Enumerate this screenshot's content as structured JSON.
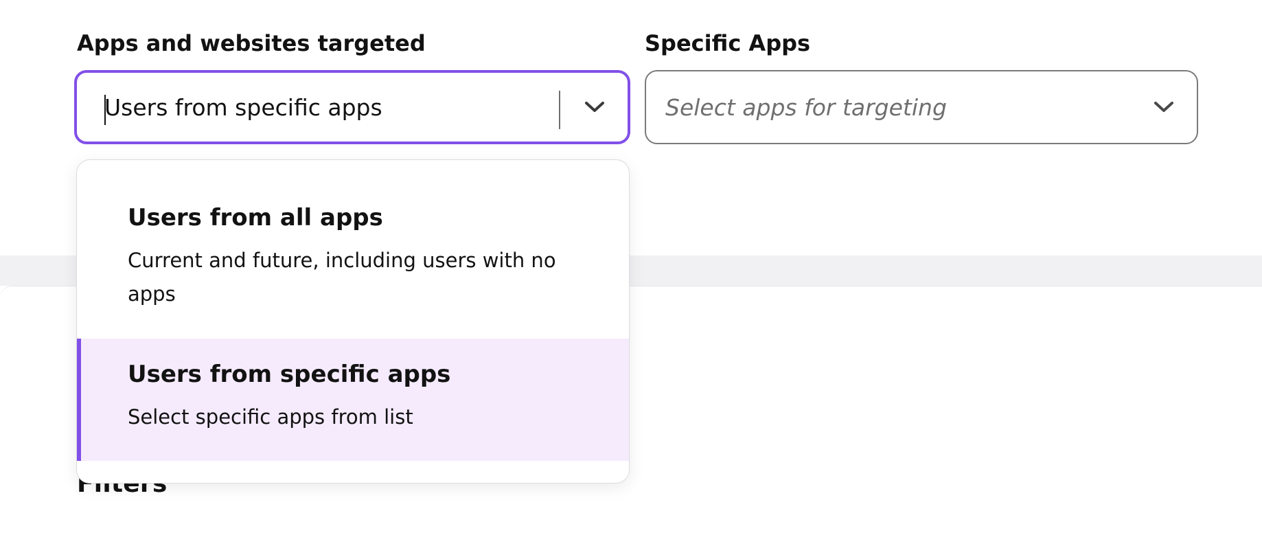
{
  "targeting": {
    "label": "Apps and websites targeted",
    "value": "Users from specific apps",
    "options": [
      {
        "title": "Users from all apps",
        "description": "Current and future, including users with no apps"
      },
      {
        "title": "Users from specific apps",
        "description": "Select specific apps from list",
        "selected": true
      }
    ]
  },
  "specific_apps": {
    "label": "Specific Apps",
    "placeholder": "Select apps for targeting"
  },
  "filters": {
    "heading": "Filters"
  },
  "colors": {
    "accent": "#8150e8",
    "selected_bg": "#f5ebfc",
    "band_bg": "#f1f1f3"
  },
  "icons": {
    "chevron": "chevron-down-icon"
  }
}
